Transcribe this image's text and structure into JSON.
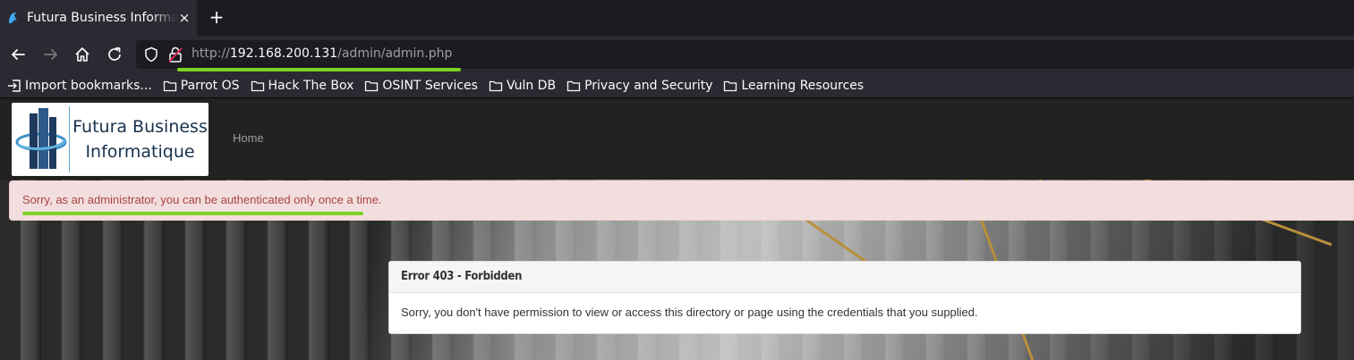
{
  "browser": {
    "tab": {
      "title": "Futura Business Informatique",
      "favicon": "parrot-icon",
      "close_label": "×"
    },
    "new_tab_label": "+",
    "url": {
      "scheme": "http://",
      "host": "192.168.200.131",
      "path": "/admin/admin.php"
    },
    "bookmarks": [
      {
        "label": "Import bookmarks...",
        "icon": "import-icon"
      },
      {
        "label": "Parrot OS",
        "icon": "folder-icon"
      },
      {
        "label": "Hack The Box",
        "icon": "folder-icon"
      },
      {
        "label": "OSINT Services",
        "icon": "folder-icon"
      },
      {
        "label": "Vuln DB",
        "icon": "folder-icon"
      },
      {
        "label": "Privacy and Security",
        "icon": "folder-icon"
      },
      {
        "label": "Learning Resources",
        "icon": "folder-icon"
      }
    ],
    "highlight_color": "#7ed321"
  },
  "site": {
    "logo_line1": "Futura Business",
    "logo_line2": "Informatique",
    "nav_home": "Home"
  },
  "alert": {
    "message": "Sorry, as an administrator, you can be authenticated only once a time."
  },
  "error_panel": {
    "heading": "Error 403 - Forbidden",
    "body": "Sorry, you don't have permission to view or access this directory or page using the credentials that you supplied."
  }
}
